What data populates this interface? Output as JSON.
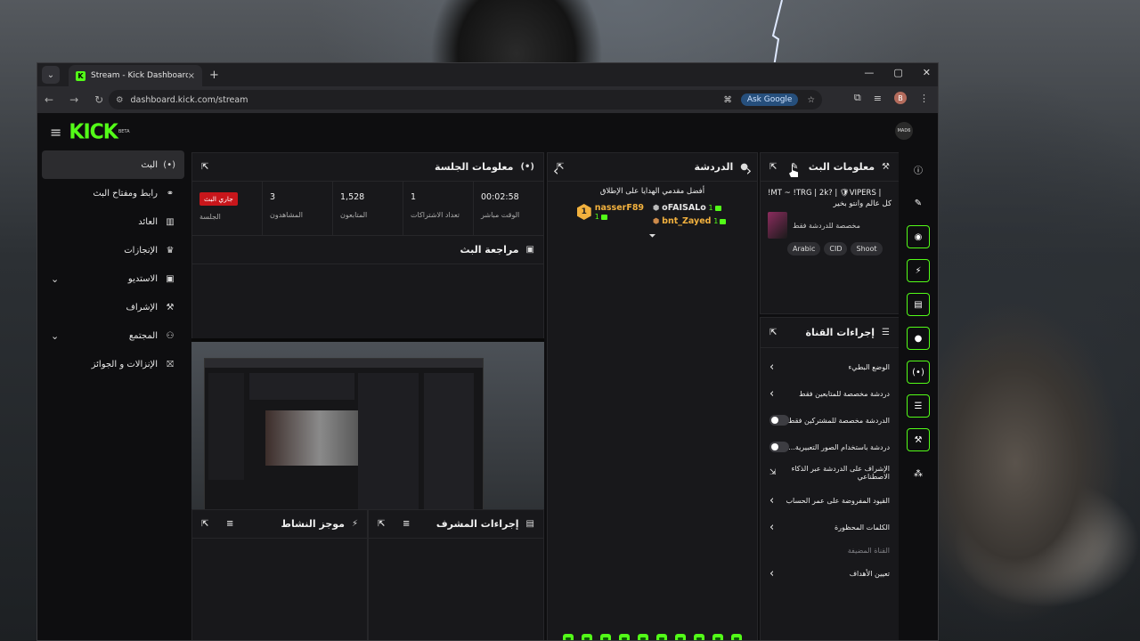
{
  "browser": {
    "tab_title": "Stream - Kick Dashboard",
    "url": "dashboard.kick.com/stream",
    "ask_google": "Ask Google",
    "profile_initial": "B",
    "close": "×",
    "new_tab": "+",
    "min": "—",
    "max": "▢",
    "winclose": "✕"
  },
  "brand": {
    "logo": "KICK",
    "beta": "BETA",
    "avatar_text": "MAD6",
    "accent": "#53fc18",
    "live_color": "#c8161b"
  },
  "sidebar": {
    "items": [
      {
        "label": "البث",
        "icon": "(•)"
      },
      {
        "label": "رابط ومفتاح البث",
        "icon": "⚭"
      },
      {
        "label": "العائد",
        "icon": "▥"
      },
      {
        "label": "الإنجازات",
        "icon": "♛"
      },
      {
        "label": "الاستديو",
        "icon": "▣"
      },
      {
        "label": "الإشراف",
        "icon": "🔧"
      },
      {
        "label": "المجتمع",
        "icon": "👥"
      },
      {
        "label": "الإنزالات و الجوائز",
        "icon": "⛝"
      }
    ]
  },
  "session": {
    "title": "معلومات الجلسة",
    "live_badge": "جاري البث",
    "cells": [
      {
        "value": "",
        "label": "الجلسة"
      },
      {
        "value": "3",
        "label": "المشاهدون"
      },
      {
        "value": "1,528",
        "label": "المتابعون"
      },
      {
        "value": "1",
        "label": "تعداد الاشتراكات"
      },
      {
        "value": "00:02:58",
        "label": "الوقت مباشر"
      }
    ]
  },
  "preview": {
    "title": "مراجعة البث"
  },
  "activity": {
    "title": "موجز النشاط"
  },
  "modactions": {
    "title": "إجراءات المشرف"
  },
  "chat": {
    "title": "الدردشة",
    "gift_title": "أفضل مقدمي الهدايا على الإطلاق",
    "top_gifter": {
      "rank": "1",
      "name": "nasserF89",
      "count": "1"
    },
    "gifters": [
      {
        "name": "oFAISALo",
        "count": "1"
      },
      {
        "name": "bnt_Zayed",
        "count": "1"
      }
    ]
  },
  "streaminfo": {
    "title": "معلومات البث",
    "stream_title": "!MT ~ !TRG | 2k? | 🛡VIPERS |",
    "stream_sub": "كل عالم وانتو بخير",
    "category_note": "مخصصة للدردشة فقط",
    "tags": [
      "Arabic",
      "CID",
      "Shoot"
    ]
  },
  "channel": {
    "title": "إجراءات القناة",
    "actions": [
      {
        "label": "الوضع البطيء",
        "type": "arrow"
      },
      {
        "label": "دردشة مخصصة للمتابعين فقط",
        "type": "arrow"
      },
      {
        "label": "الدردشة مخصصة للمشتركين فقط",
        "type": "toggle"
      },
      {
        "label": "دردشة باستخدام الصور التعبيرية...",
        "type": "toggle"
      },
      {
        "label": "الإشراف على الدردشة عبر الذكاء الاصطناعي",
        "type": "ext"
      },
      {
        "label": "القيود المفروضة على عمر الحساب",
        "type": "arrow"
      },
      {
        "label": "الكلمات المحظورة",
        "type": "arrow"
      }
    ],
    "subhead": "القناة المضيفة",
    "goals": "تعيين الأهداف"
  }
}
